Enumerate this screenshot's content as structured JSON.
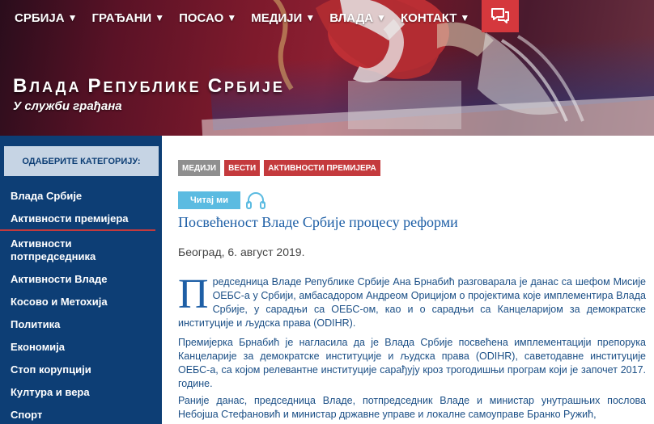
{
  "nav": {
    "items": [
      {
        "label": "СРБИЈА",
        "caret": "▼"
      },
      {
        "label": "ГРАЂАНИ",
        "caret": "▼"
      },
      {
        "label": "ПОСАО",
        "caret": "▼"
      },
      {
        "label": "МЕДИЈИ",
        "caret": "▼"
      },
      {
        "label": "ВЛАДА",
        "caret": "▼"
      },
      {
        "label": "КОНТАКТ",
        "caret": "▼"
      }
    ],
    "chat_icon": "chat-bubbles-icon"
  },
  "site": {
    "title_big_1": "В",
    "title_small_1": "ЛАДА ",
    "title_big_2": "Р",
    "title_small_2": "ЕПУБЛИКЕ ",
    "title_big_3": "С",
    "title_small_3": "РБИЈЕ",
    "subtitle": "У служби грађана"
  },
  "sidebar": {
    "heading": "ОДАБЕРИТЕ КАТЕГОРИЈУ:",
    "items": [
      {
        "label": "Влада Србије"
      },
      {
        "label": "Активности премијера"
      },
      {
        "label": "Активности потпредседника"
      },
      {
        "label": "Активности Владе"
      },
      {
        "label": "Косово и Метохија"
      },
      {
        "label": "Политика"
      },
      {
        "label": "Економија"
      },
      {
        "label": "Стоп корупцији"
      },
      {
        "label": "Култура и вера"
      },
      {
        "label": "Спорт"
      }
    ]
  },
  "main": {
    "tags": [
      {
        "label": "МЕДИЈИ"
      },
      {
        "label": "ВЕСТИ"
      },
      {
        "label": "АКТИВНОСТИ ПРЕМИЈЕРА"
      }
    ],
    "read_button": "Читај ми",
    "headphones_icon": "headphones-icon",
    "title": "Посвећеност Владе Србије процесу реформи",
    "date": "Београд, 6. август 2019.",
    "dropcap": "П",
    "p1_rest": "редседница Владе Републике Србије Ана Брнабић разговарала је данас са шефом Мисије ОЕБС-а у Србији, амбасадором Андреом Орицијом о пројектима које имплементира Влада Србије, у сарадњи са ОЕБС-ом, као и о сарадњи са Канцеларијом за демократске институције и људска права (ODIHR).",
    "p2": "Премијерка Брнабић је нагласила да је Влада Србије посвећена имплементацији препорука Канцеларије за демократске институције и људска права (ODIHR), саветодавне институције ОЕБС-а, са којом релевантне институције сарађују кроз трогодишњи програм који је започет 2017. године.",
    "p3": "Раније данас, председница Владе, потпредседник Владе и министар унутрашњих послова Небојша Стефановић и министар државне управе и локалне самоуправе Бранко Ружић,"
  },
  "colors": {
    "sidebar_bg": "#0d3e75",
    "accent_red": "#c43a3d",
    "link_blue": "#1e5fa6",
    "read_blue": "#5bbbe1"
  }
}
